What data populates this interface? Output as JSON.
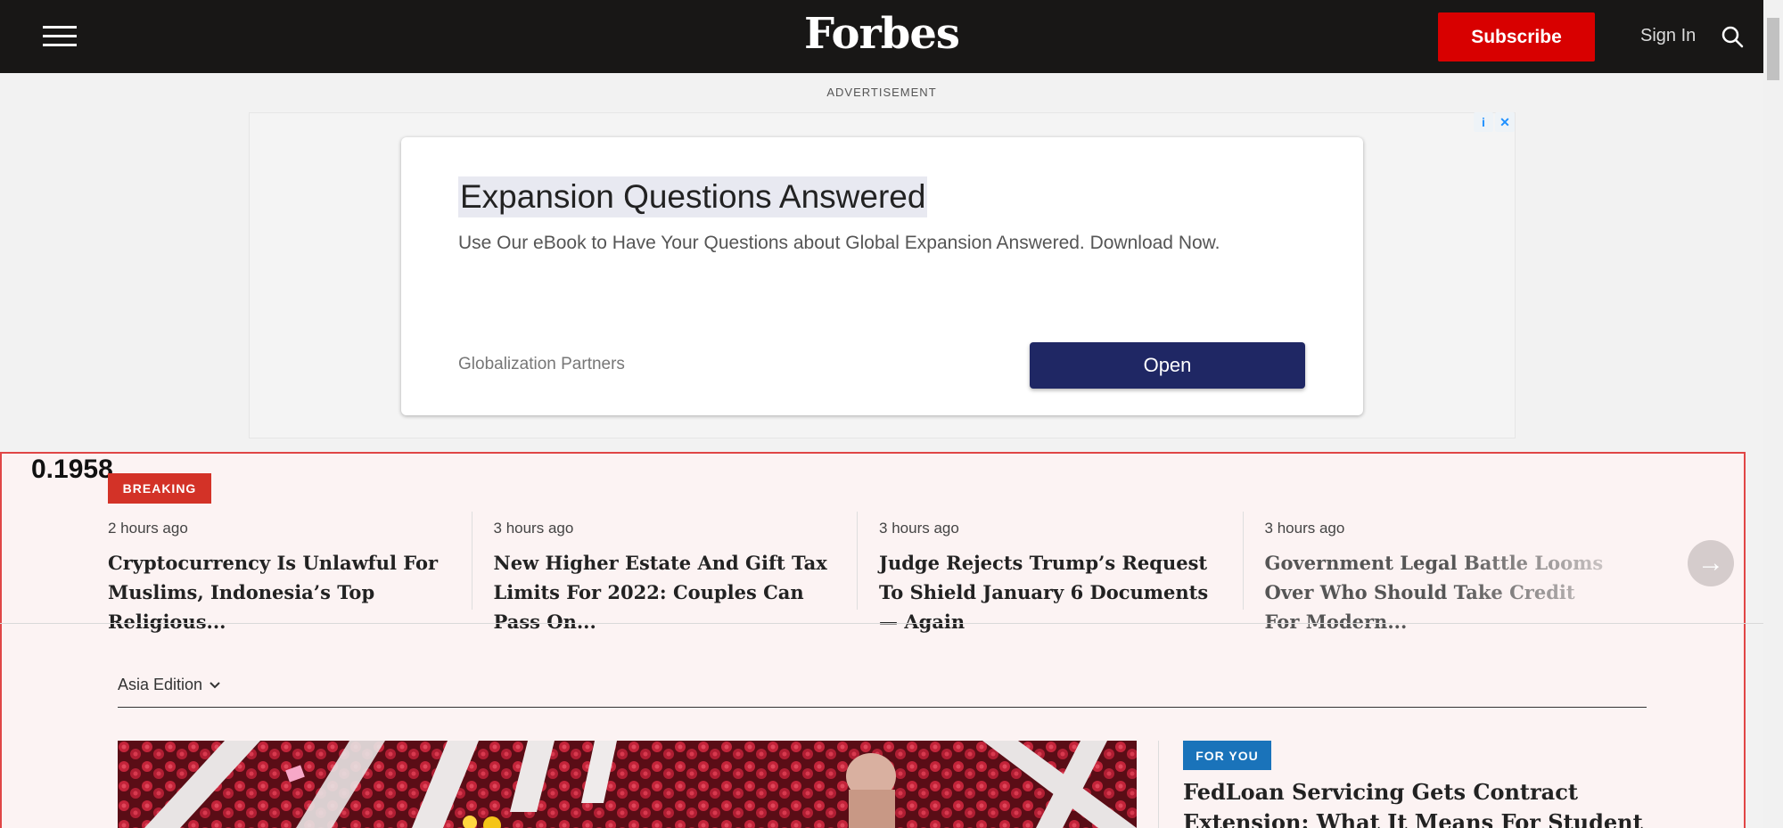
{
  "header": {
    "logo": "Forbes",
    "subscribe_label": "Subscribe",
    "signin_label": "Sign In"
  },
  "ad": {
    "label": "ADVERTISEMENT",
    "title": "Expansion Questions Answered",
    "description": "Use Our eBook to Have Your Questions about Global Expansion Answered. Download Now.",
    "brand": "Globalization Partners",
    "cta": "Open",
    "info_badge": "i",
    "close_badge": "✕"
  },
  "overlay_score": "0.1958",
  "breaking": {
    "label": "BREAKING",
    "stories": [
      {
        "time": "2 hours ago",
        "headline": "Cryptocurrency Is Unlawful For Muslims, Indonesia’s Top Religious..."
      },
      {
        "time": "3 hours ago",
        "headline": "New Higher Estate And Gift Tax Limits For 2022: Couples Can Pass On..."
      },
      {
        "time": "3 hours ago",
        "headline": "Judge Rejects Trump’s Request To Shield January 6 Documents — Again"
      },
      {
        "time": "3 hours ago",
        "headline": "Government Legal Battle Looms Over Who Should Take Credit For Modern..."
      }
    ],
    "next_arrow": "→"
  },
  "edition": {
    "label": "Asia Edition"
  },
  "for_you": {
    "badge": "FOR YOU",
    "headline": "FedLoan Servicing Gets Contract Extension: What It Means For Student Loan Borrowers"
  },
  "colors": {
    "header_bg": "#181716",
    "subscribe": "#d80000",
    "breaking": "#d33227",
    "for_you": "#1a73ba",
    "ad_button": "#1f2764"
  }
}
